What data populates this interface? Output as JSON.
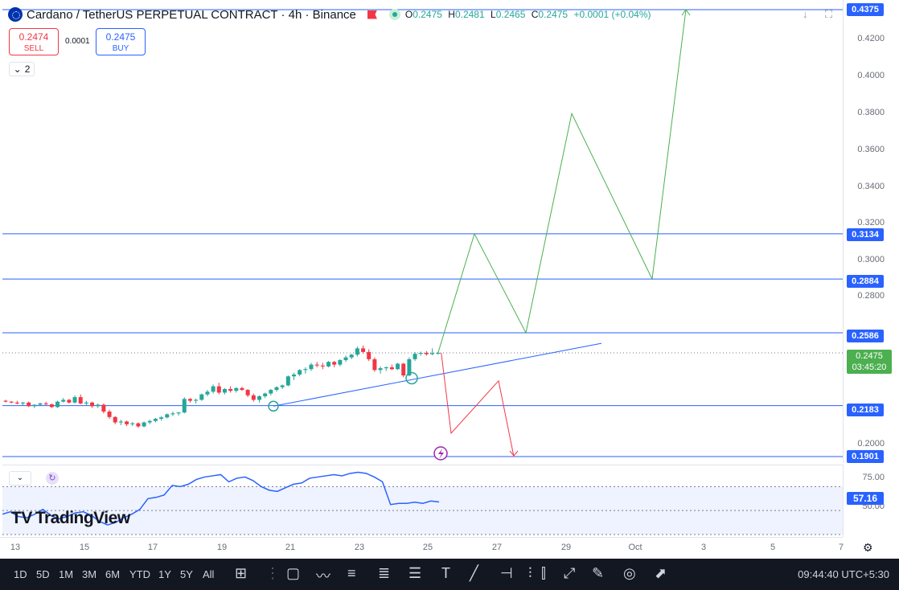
{
  "header": {
    "title": "Cardano / TetherUS PERPETUAL CONTRACT · 4h · Binance",
    "ohlc": [
      {
        "k": "O",
        "v": "0.2475"
      },
      {
        "k": "H",
        "v": "0.2481"
      },
      {
        "k": "L",
        "v": "0.2465"
      },
      {
        "k": "C",
        "v": "0.2475"
      }
    ],
    "change": "+0.0001 (+0.04%)"
  },
  "trade": {
    "sell_price": "0.2474",
    "sell_label": "SELL",
    "spread": "0.0001",
    "buy_price": "0.2475",
    "buy_label": "BUY"
  },
  "indicator_count": "2",
  "price_axis": {
    "ticks": [
      "0.4200",
      "0.4000",
      "0.3800",
      "0.3600",
      "0.3400",
      "0.3200",
      "0.3000",
      "0.2800",
      "0.2000"
    ],
    "levels": [
      "0.4375",
      "0.3134",
      "0.2884",
      "0.2586",
      "0.2183",
      "0.1901"
    ],
    "current_price": "0.2475",
    "countdown": "03:45:20"
  },
  "rsi": {
    "ticks": [
      "75.00",
      "50.00"
    ],
    "value": "57.16"
  },
  "time_axis": [
    "13",
    "15",
    "17",
    "19",
    "21",
    "23",
    "25",
    "27",
    "29",
    "Oct",
    "3",
    "5",
    "7"
  ],
  "branding": "TradingView",
  "toolbar": {
    "ranges": [
      "1D",
      "5D",
      "1M",
      "3M",
      "6M",
      "YTD",
      "1Y",
      "5Y",
      "All"
    ],
    "clock": "09:44:40 UTC+5:30"
  },
  "colors": {
    "up": "#26a69a",
    "down": "#f23645",
    "level_line": "#2962ff",
    "bull_path": "#4caf50",
    "bear_path": "#f23645",
    "rsi_line": "#2962ff"
  },
  "chart_data": {
    "type": "candlestick",
    "symbol": "ADAUSDT.P",
    "interval": "4h",
    "price_range": [
      0.188,
      0.44
    ],
    "horizontal_levels": [
      0.4375,
      0.3134,
      0.2884,
      0.2586,
      0.2183,
      0.1901
    ],
    "current_price": 0.2475,
    "candles": [
      [
        0.221,
        0.2215,
        0.22,
        0.2205
      ],
      [
        0.2205,
        0.2208,
        0.2196,
        0.22
      ],
      [
        0.22,
        0.221,
        0.219,
        0.2195
      ],
      [
        0.2195,
        0.2203,
        0.2185,
        0.22
      ],
      [
        0.22,
        0.2205,
        0.2175,
        0.218
      ],
      [
        0.218,
        0.219,
        0.217,
        0.2188
      ],
      [
        0.2188,
        0.22,
        0.218,
        0.2195
      ],
      [
        0.2195,
        0.2205,
        0.2185,
        0.219
      ],
      [
        0.219,
        0.2195,
        0.217,
        0.2175
      ],
      [
        0.2175,
        0.221,
        0.217,
        0.2205
      ],
      [
        0.2205,
        0.2225,
        0.22,
        0.2215
      ],
      [
        0.2215,
        0.222,
        0.2195,
        0.22
      ],
      [
        0.22,
        0.224,
        0.2195,
        0.223
      ],
      [
        0.223,
        0.2245,
        0.219,
        0.2195
      ],
      [
        0.2195,
        0.221,
        0.2185,
        0.22
      ],
      [
        0.22,
        0.2205,
        0.217,
        0.218
      ],
      [
        0.218,
        0.2195,
        0.217,
        0.2188
      ],
      [
        0.2188,
        0.2195,
        0.214,
        0.215
      ],
      [
        0.215,
        0.216,
        0.211,
        0.212
      ],
      [
        0.212,
        0.2125,
        0.208,
        0.209
      ],
      [
        0.209,
        0.2105,
        0.2075,
        0.2095
      ],
      [
        0.2095,
        0.21,
        0.207,
        0.208
      ],
      [
        0.208,
        0.2092,
        0.207,
        0.2085
      ],
      [
        0.2085,
        0.209,
        0.206,
        0.2068
      ],
      [
        0.2068,
        0.2095,
        0.2063,
        0.209
      ],
      [
        0.209,
        0.2105,
        0.208,
        0.2098
      ],
      [
        0.2098,
        0.2115,
        0.209,
        0.211
      ],
      [
        0.211,
        0.2125,
        0.21,
        0.2118
      ],
      [
        0.2118,
        0.214,
        0.2112,
        0.2135
      ],
      [
        0.2135,
        0.215,
        0.2125,
        0.214
      ],
      [
        0.214,
        0.2148,
        0.2128,
        0.2145
      ],
      [
        0.2145,
        0.223,
        0.214,
        0.222
      ],
      [
        0.222,
        0.2225,
        0.22,
        0.221
      ],
      [
        0.221,
        0.2222,
        0.2195,
        0.2215
      ],
      [
        0.2215,
        0.225,
        0.221,
        0.2245
      ],
      [
        0.2245,
        0.227,
        0.2235,
        0.226
      ],
      [
        0.226,
        0.23,
        0.225,
        0.229
      ],
      [
        0.229,
        0.231,
        0.2245,
        0.2255
      ],
      [
        0.2255,
        0.228,
        0.2245,
        0.2275
      ],
      [
        0.2275,
        0.229,
        0.2255,
        0.2265
      ],
      [
        0.2265,
        0.2285,
        0.2255,
        0.228
      ],
      [
        0.228,
        0.2288,
        0.2265,
        0.227
      ],
      [
        0.227,
        0.2275,
        0.223,
        0.224
      ],
      [
        0.224,
        0.225,
        0.2205,
        0.2215
      ],
      [
        0.2215,
        0.224,
        0.22,
        0.2235
      ],
      [
        0.2235,
        0.2255,
        0.2225,
        0.225
      ],
      [
        0.225,
        0.2275,
        0.224,
        0.227
      ],
      [
        0.227,
        0.229,
        0.226,
        0.2285
      ],
      [
        0.2285,
        0.23,
        0.2275,
        0.2295
      ],
      [
        0.2295,
        0.235,
        0.229,
        0.2345
      ],
      [
        0.2345,
        0.2365,
        0.2325,
        0.2355
      ],
      [
        0.2355,
        0.2385,
        0.2345,
        0.238
      ],
      [
        0.238,
        0.2395,
        0.236,
        0.2385
      ],
      [
        0.2385,
        0.242,
        0.2375,
        0.241
      ],
      [
        0.241,
        0.2425,
        0.2395,
        0.2405
      ],
      [
        0.2405,
        0.242,
        0.2385,
        0.24
      ],
      [
        0.24,
        0.243,
        0.2395,
        0.2425
      ],
      [
        0.2425,
        0.243,
        0.2395,
        0.241
      ],
      [
        0.241,
        0.244,
        0.24,
        0.2435
      ],
      [
        0.2435,
        0.246,
        0.2425,
        0.245
      ],
      [
        0.245,
        0.247,
        0.244,
        0.2465
      ],
      [
        0.2465,
        0.251,
        0.2455,
        0.25
      ],
      [
        0.25,
        0.2515,
        0.247,
        0.248
      ],
      [
        0.248,
        0.2495,
        0.243,
        0.244
      ],
      [
        0.244,
        0.245,
        0.237,
        0.238
      ],
      [
        0.238,
        0.24,
        0.236,
        0.239
      ],
      [
        0.239,
        0.24,
        0.2375,
        0.2395
      ],
      [
        0.2395,
        0.241,
        0.238,
        0.2385
      ],
      [
        0.2385,
        0.242,
        0.238,
        0.2415
      ],
      [
        0.2415,
        0.242,
        0.234,
        0.235
      ],
      [
        0.235,
        0.245,
        0.2345,
        0.244
      ],
      [
        0.244,
        0.248,
        0.243,
        0.247
      ],
      [
        0.247,
        0.2482,
        0.246,
        0.2475
      ],
      [
        0.2475,
        0.2485,
        0.246,
        0.2468
      ],
      [
        0.2468,
        0.25,
        0.2462,
        0.2474
      ],
      [
        0.2474,
        0.2481,
        0.2465,
        0.2475
      ]
    ],
    "trendline": [
      [
        0.218,
        0.2528
      ]
    ],
    "bullish_projection": [
      0.2475,
      0.3134,
      0.2586,
      0.38,
      0.2884,
      0.4375
    ],
    "bearish_projection": [
      0.2475,
      0.203,
      0.232,
      0.1901
    ],
    "rsi_series": [
      47,
      49,
      45,
      44,
      47,
      51,
      46,
      43,
      45,
      48,
      49,
      46,
      41,
      38,
      40,
      44,
      47,
      51,
      60,
      61,
      63,
      71,
      70,
      72,
      76,
      78,
      79,
      80,
      74,
      77,
      78,
      75,
      70,
      67,
      66,
      69,
      72,
      73,
      77,
      78,
      79,
      80,
      79,
      81,
      82,
      81,
      78,
      74,
      55,
      56,
      56,
      57,
      56,
      58,
      57.16
    ],
    "rsi_range": [
      30,
      85
    ],
    "rsi_bands": [
      70,
      50,
      30
    ]
  }
}
